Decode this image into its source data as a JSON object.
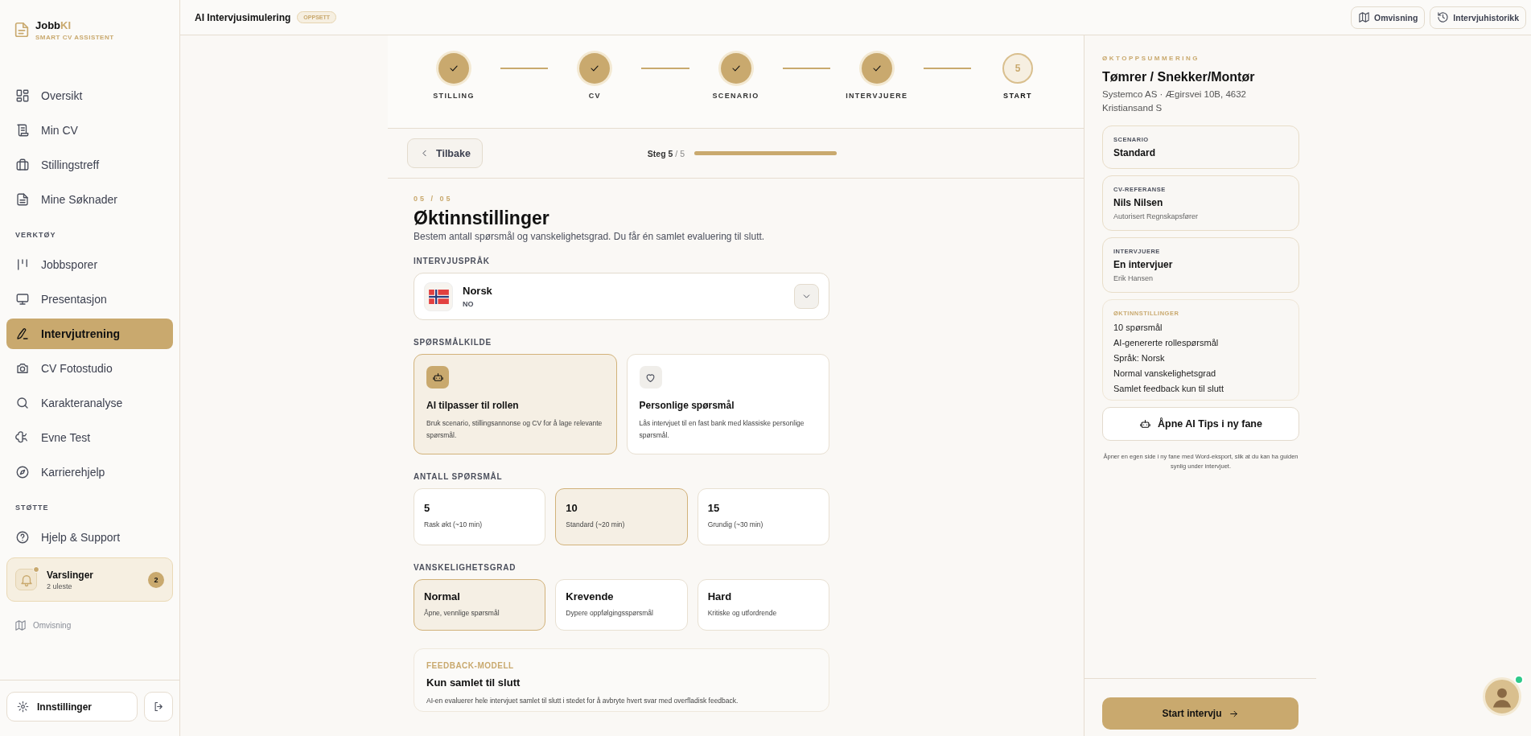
{
  "brand": {
    "name": "Jobb",
    "accent": "KI",
    "tagline": "SMART CV ASSISTENT"
  },
  "sidebar": {
    "sections": [
      {
        "items": [
          {
            "label": "Oversikt",
            "selected": false
          },
          {
            "label": "Min CV",
            "selected": false
          },
          {
            "label": "Stillingstreff",
            "selected": false
          },
          {
            "label": "Mine Søknader",
            "selected": false
          }
        ]
      },
      {
        "heading": "VERKTØY",
        "items": [
          {
            "label": "Jobbsporer",
            "selected": false
          },
          {
            "label": "Presentasjon",
            "selected": false
          },
          {
            "label": "Intervjutrening",
            "selected": true
          },
          {
            "label": "CV Fotostudio",
            "selected": false
          },
          {
            "label": "Karakteranalyse",
            "selected": false
          },
          {
            "label": "Evne Test",
            "selected": false
          },
          {
            "label": "Karrierehjelp",
            "selected": false
          }
        ]
      },
      {
        "heading": "STØTTE",
        "items": [
          {
            "label": "Hjelp & Support",
            "selected": false
          }
        ]
      }
    ],
    "notifications": {
      "title": "Varslinger",
      "subtitle": "2 uleste",
      "count": "2",
      "has_new": true
    },
    "tour_link": "Omvisning",
    "settings_button": "Innstillinger"
  },
  "header": {
    "title": "AI Intervjusimulering",
    "badge": "OPPSETT",
    "buttons": [
      "Omvisning",
      "Intervjuhistorikk"
    ]
  },
  "stepper": {
    "steps": [
      {
        "label": "STILLING",
        "done": true
      },
      {
        "label": "CV",
        "done": true
      },
      {
        "label": "SCENARIO",
        "done": true
      },
      {
        "label": "INTERVJUERE",
        "done": true
      },
      {
        "label": "START",
        "number": "5",
        "done": false
      }
    ]
  },
  "step_nav": {
    "back": "Tilbake",
    "prefix": "Steg",
    "current": "5",
    "total": "/ 5",
    "level": 1
  },
  "form": {
    "step_index": "05 / 05",
    "title": "Øktinnstillinger",
    "subtitle": "Bestem antall spørsmål og vanskelighetsgrad. Du får én samlet evaluering til slutt.",
    "language": {
      "label": "INTERVJUSPRÅK",
      "name": "Norsk",
      "code": "NO"
    },
    "source": {
      "label": "SPØRSMÅLKILDE",
      "options": [
        {
          "title": "AI tilpasser til rollen",
          "desc": "Bruk scenario, stillingsannonse og CV for å lage relevante spørsmål.",
          "selected": true
        },
        {
          "title": "Personlige spørsmål",
          "desc": "Lås intervjuet til en fast bank med klassiske personlige spørsmål.",
          "selected": false
        }
      ]
    },
    "count": {
      "label": "ANTALL SPØRSMÅL",
      "options": [
        {
          "value": "5",
          "desc": "Rask økt (~10 min)",
          "selected": false
        },
        {
          "value": "10",
          "desc": "Standard (~20 min)",
          "selected": true
        },
        {
          "value": "15",
          "desc": "Grundig (~30 min)",
          "selected": false
        }
      ]
    },
    "difficulty": {
      "label": "VANSKELIGHETSGRAD",
      "options": [
        {
          "value": "Normal",
          "desc": "Åpne, vennlige spørsmål",
          "selected": true
        },
        {
          "value": "Krevende",
          "desc": "Dypere oppfølgingsspørsmål",
          "selected": false
        },
        {
          "value": "Hard",
          "desc": "Kritiske og utfordrende",
          "selected": false
        }
      ]
    },
    "feedback": {
      "label": "FEEDBACK-MODELL",
      "title": "Kun samlet til slutt",
      "desc": "AI-en evaluerer hele intervjuet samlet til slutt i stedet for å avbryte hvert svar med overfladisk feedback."
    }
  },
  "summary": {
    "eyebrow": "ØKTOPPSUMMERING",
    "title": "Tømrer / Snekker/Montør",
    "address": "Systemco AS · Ægirsvei 10B, 4632 Kristiansand S",
    "cards": [
      {
        "label": "SCENARIO",
        "value": "Standard"
      },
      {
        "label": "CV-REFERANSE",
        "value": "Nils Nilsen",
        "detail": "Autorisert Regnskapsfører"
      },
      {
        "label": "INTERVJUERE",
        "value": "En intervjuer",
        "detail": "Erik Hansen"
      }
    ],
    "settings": {
      "label": "ØKTINNSTILLINGER",
      "lines": [
        "10 spørsmål",
        "AI-genererte rollespørsmål",
        "Språk: Norsk",
        "Normal vanskelighetsgrad",
        "Samlet feedback kun til slutt"
      ]
    },
    "tips_button": "Åpne AI Tips i ny fane",
    "note": "Åpner en egen side i ny fane med Word-eksport, slik at du kan ha guiden synlig under intervjuet.",
    "start_button": "Start intervju"
  },
  "assistant": {
    "online": true
  }
}
